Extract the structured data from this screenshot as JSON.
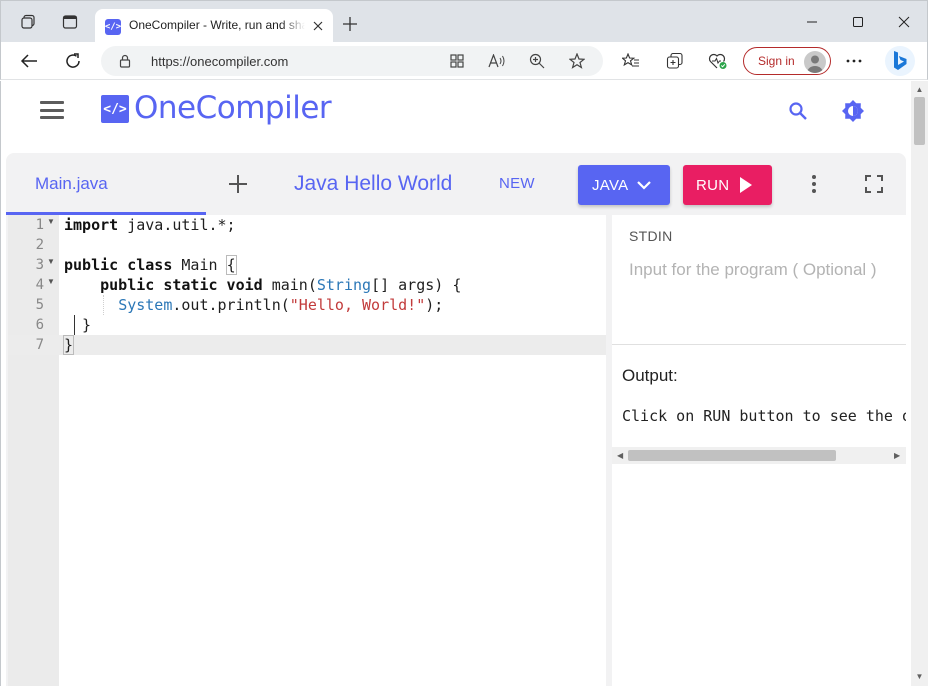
{
  "browser": {
    "tab_title": "OneCompiler - Write, run and share Java code online",
    "favicon_glyph": "</>",
    "url": "https://onecompiler.com",
    "sign_in_label": "Sign in"
  },
  "header": {
    "logo_mark": "</>",
    "logo_text": "OneCompiler",
    "icons": [
      "search-icon",
      "theme-toggle-icon"
    ]
  },
  "toolbar": {
    "file_tab": "Main.java",
    "snippet_title": "Java Hello World",
    "new_label": "NEW",
    "language_label": "JAVA",
    "run_label": "RUN"
  },
  "editor": {
    "active_line": 7,
    "lines": [
      {
        "num": "1",
        "fold": true,
        "code": "import java.util.*;"
      },
      {
        "num": "2",
        "fold": false,
        "code": ""
      },
      {
        "num": "3",
        "fold": true,
        "code": "public class Main {"
      },
      {
        "num": "4",
        "fold": true,
        "code": "    public static void main(String[] args) {"
      },
      {
        "num": "5",
        "fold": false,
        "code": "      System.out.println(\"Hello, World!\");"
      },
      {
        "num": "6",
        "fold": false,
        "code": "  }"
      },
      {
        "num": "7",
        "fold": false,
        "code": "}"
      }
    ]
  },
  "stdin": {
    "label": "STDIN",
    "placeholder": "Input for the program ( Optional )"
  },
  "output": {
    "label": "Output:",
    "text": "Click on RUN button to see the output"
  },
  "colors": {
    "brand": "#5865f2",
    "run": "#e91e63",
    "keyword": "#111111",
    "type": "#2b77b7",
    "string": "#c23b3b"
  }
}
